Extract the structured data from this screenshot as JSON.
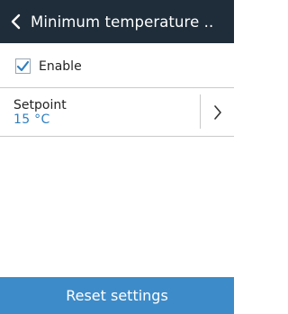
{
  "header": {
    "title": "Minimum temperature ..",
    "back_icon": "chevron-left-icon"
  },
  "enable": {
    "label": "Enable",
    "checked": true,
    "check_icon": "check-icon"
  },
  "setpoint": {
    "label": "Setpoint",
    "value": "15 °C",
    "chevron_icon": "chevron-right-icon"
  },
  "footer": {
    "reset_label": "Reset settings"
  },
  "colors": {
    "header_bg": "#1f2d3a",
    "accent": "#3d8bc9",
    "value_text": "#2f7fc1"
  }
}
